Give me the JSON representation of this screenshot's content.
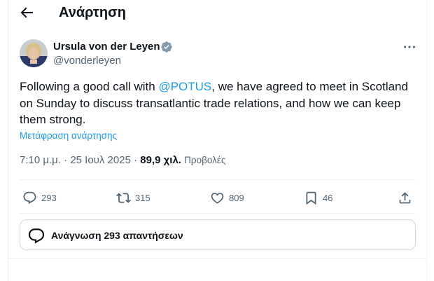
{
  "header": {
    "title": "Ανάρτηση",
    "back_icon": "arrow-left-icon"
  },
  "author": {
    "name": "Ursula von der Leyen",
    "handle": "@vonderleyen",
    "verified_icon": "verified-badge-icon",
    "verified_color": "#829aab"
  },
  "tweet": {
    "text_before": "Following a good call with ",
    "mention": "@POTUS",
    "text_after": ", we have agreed to meet in Scotland on Sunday to discuss transatlantic trade relations, and how we can keep them strong.",
    "translate_label": "Μετάφραση ανάρτησης",
    "time": "7:10 μ.μ.",
    "separator": "·",
    "date": "25 Ιουλ 2025",
    "views_count": "89,9 χιλ.",
    "views_label": "Προβολές"
  },
  "actions": {
    "replies": "293",
    "reposts": "315",
    "likes": "809",
    "bookmarks": "46"
  },
  "replies_box": {
    "label": "Ανάγνωση 293 απαντήσεων"
  },
  "colors": {
    "accent": "#1d9bf0",
    "text": "#0f1419",
    "muted": "#536471",
    "border": "#cfd9de"
  }
}
